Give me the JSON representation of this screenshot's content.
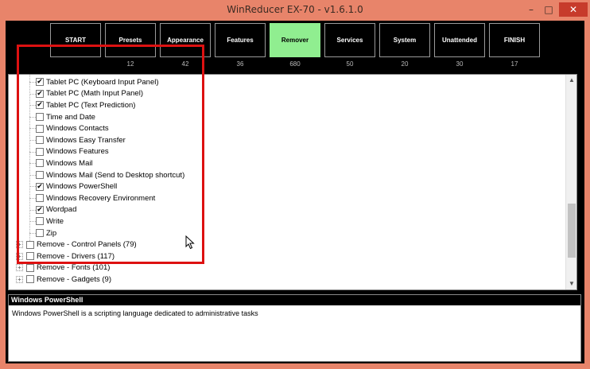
{
  "window": {
    "title": "WinReducer EX-70 - v1.6.1.0",
    "minimize": "–",
    "maximize": "□",
    "close": "✕"
  },
  "nav": [
    {
      "label": "START",
      "count": ""
    },
    {
      "label": "Presets",
      "count": "12"
    },
    {
      "label": "Appearance",
      "count": "42"
    },
    {
      "label": "Features",
      "count": "36"
    },
    {
      "label": "Remover",
      "count": "680",
      "active": true
    },
    {
      "label": "Services",
      "count": "50"
    },
    {
      "label": "System",
      "count": "20"
    },
    {
      "label": "Unattended",
      "count": "30"
    },
    {
      "label": "FINISH",
      "count": "17"
    }
  ],
  "tree": {
    "children": [
      {
        "label": "Tablet PC (Keyboard Input Panel)",
        "checked": true
      },
      {
        "label": "Tablet PC (Math Input Panel)",
        "checked": true
      },
      {
        "label": "Tablet PC (Text Prediction)",
        "checked": true
      },
      {
        "label": "Time and Date",
        "checked": false
      },
      {
        "label": "Windows Contacts",
        "checked": false
      },
      {
        "label": "Windows Easy Transfer",
        "checked": false
      },
      {
        "label": "Windows Features",
        "checked": false
      },
      {
        "label": "Windows Mail",
        "checked": false
      },
      {
        "label": "Windows Mail (Send to Desktop shortcut)",
        "checked": false
      },
      {
        "label": "Windows PowerShell",
        "checked": true
      },
      {
        "label": "Windows Recovery Environment",
        "checked": false
      },
      {
        "label": "Wordpad",
        "checked": true
      },
      {
        "label": "Write",
        "checked": false
      },
      {
        "label": "Zip",
        "checked": false
      }
    ],
    "groups": [
      {
        "label": "Remove - Control Panels (79)",
        "expander": "+"
      },
      {
        "label": "Remove - Drivers (117)",
        "expander": "+"
      },
      {
        "label": "Remove - Fonts (101)",
        "expander": "+"
      },
      {
        "label": "Remove - Gadgets (9)",
        "expander": "+"
      }
    ],
    "scroll_up": "▲",
    "scroll_down": "▼"
  },
  "description": {
    "title": "Windows PowerShell",
    "text": "Windows PowerShell is a scripting language dedicated to administrative tasks"
  },
  "colors": {
    "title_bar": "#e8846a",
    "active_tab": "#90ee90",
    "highlight_border": "#dd1111",
    "close_button": "#c73b2b"
  }
}
